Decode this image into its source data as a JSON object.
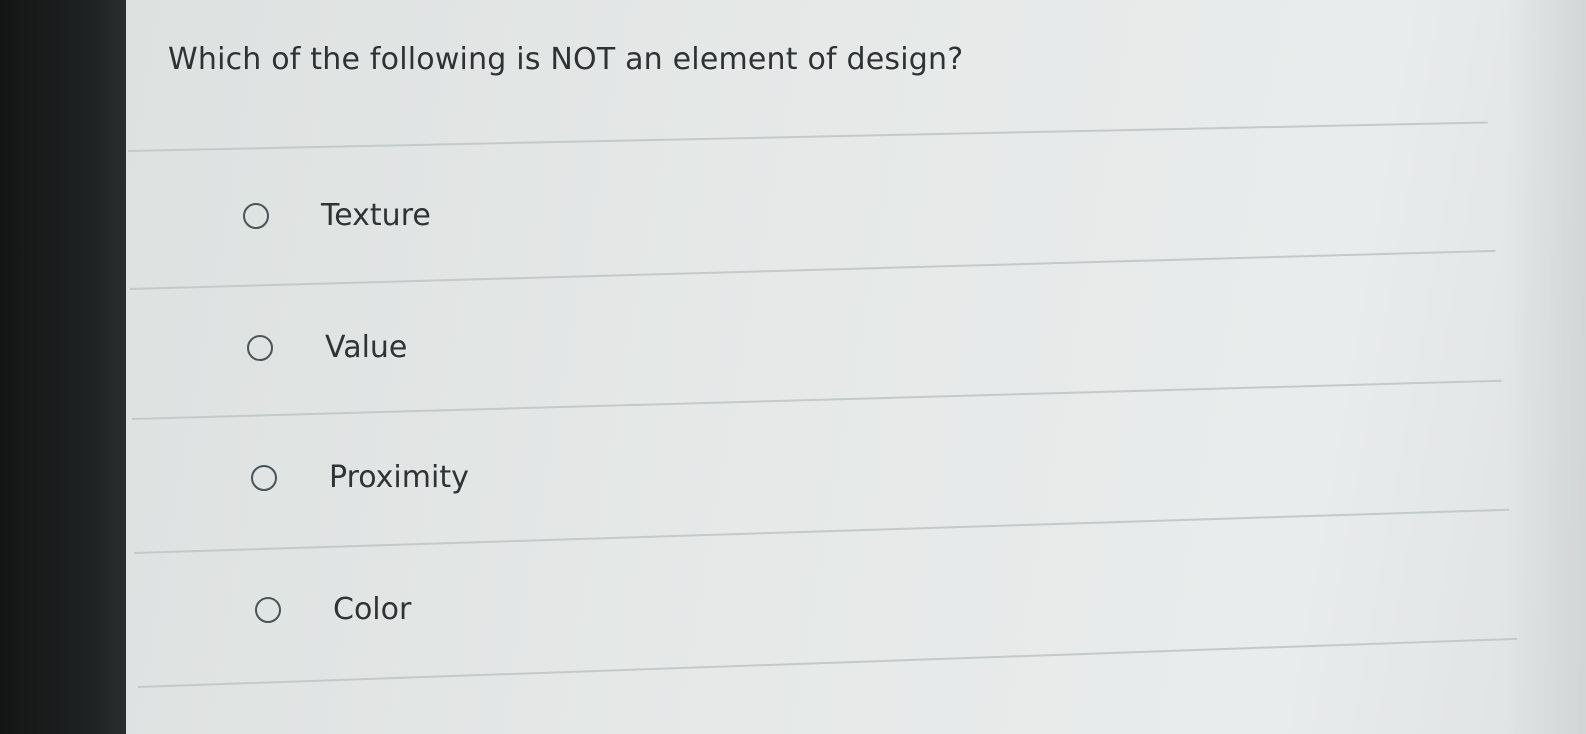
{
  "question": {
    "text": "Which of the following is NOT an element of design?"
  },
  "options": [
    {
      "label": "Texture",
      "selected": false
    },
    {
      "label": "Value",
      "selected": false
    },
    {
      "label": "Proximity",
      "selected": false
    },
    {
      "label": "Color",
      "selected": false
    }
  ],
  "colors": {
    "text": "#2f3335",
    "radio_border": "#4a5458",
    "divider": "#c4c9c9",
    "background": "#e3e6e6"
  }
}
